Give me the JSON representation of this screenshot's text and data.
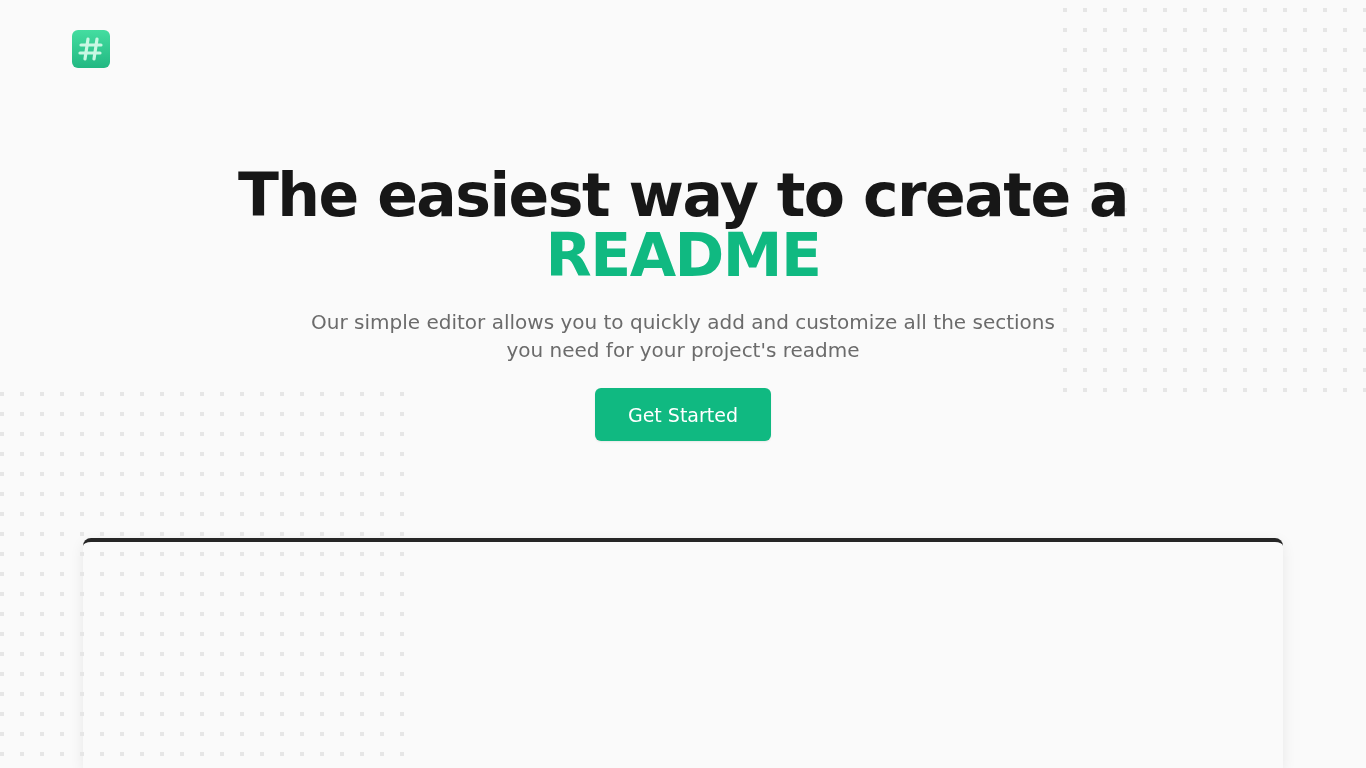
{
  "hero": {
    "title": "The easiest way to create a",
    "title_accent": "README",
    "subtitle": "Our simple editor allows you to quickly add and customize all the sections you need for your project's readme",
    "button": "Get Started"
  }
}
